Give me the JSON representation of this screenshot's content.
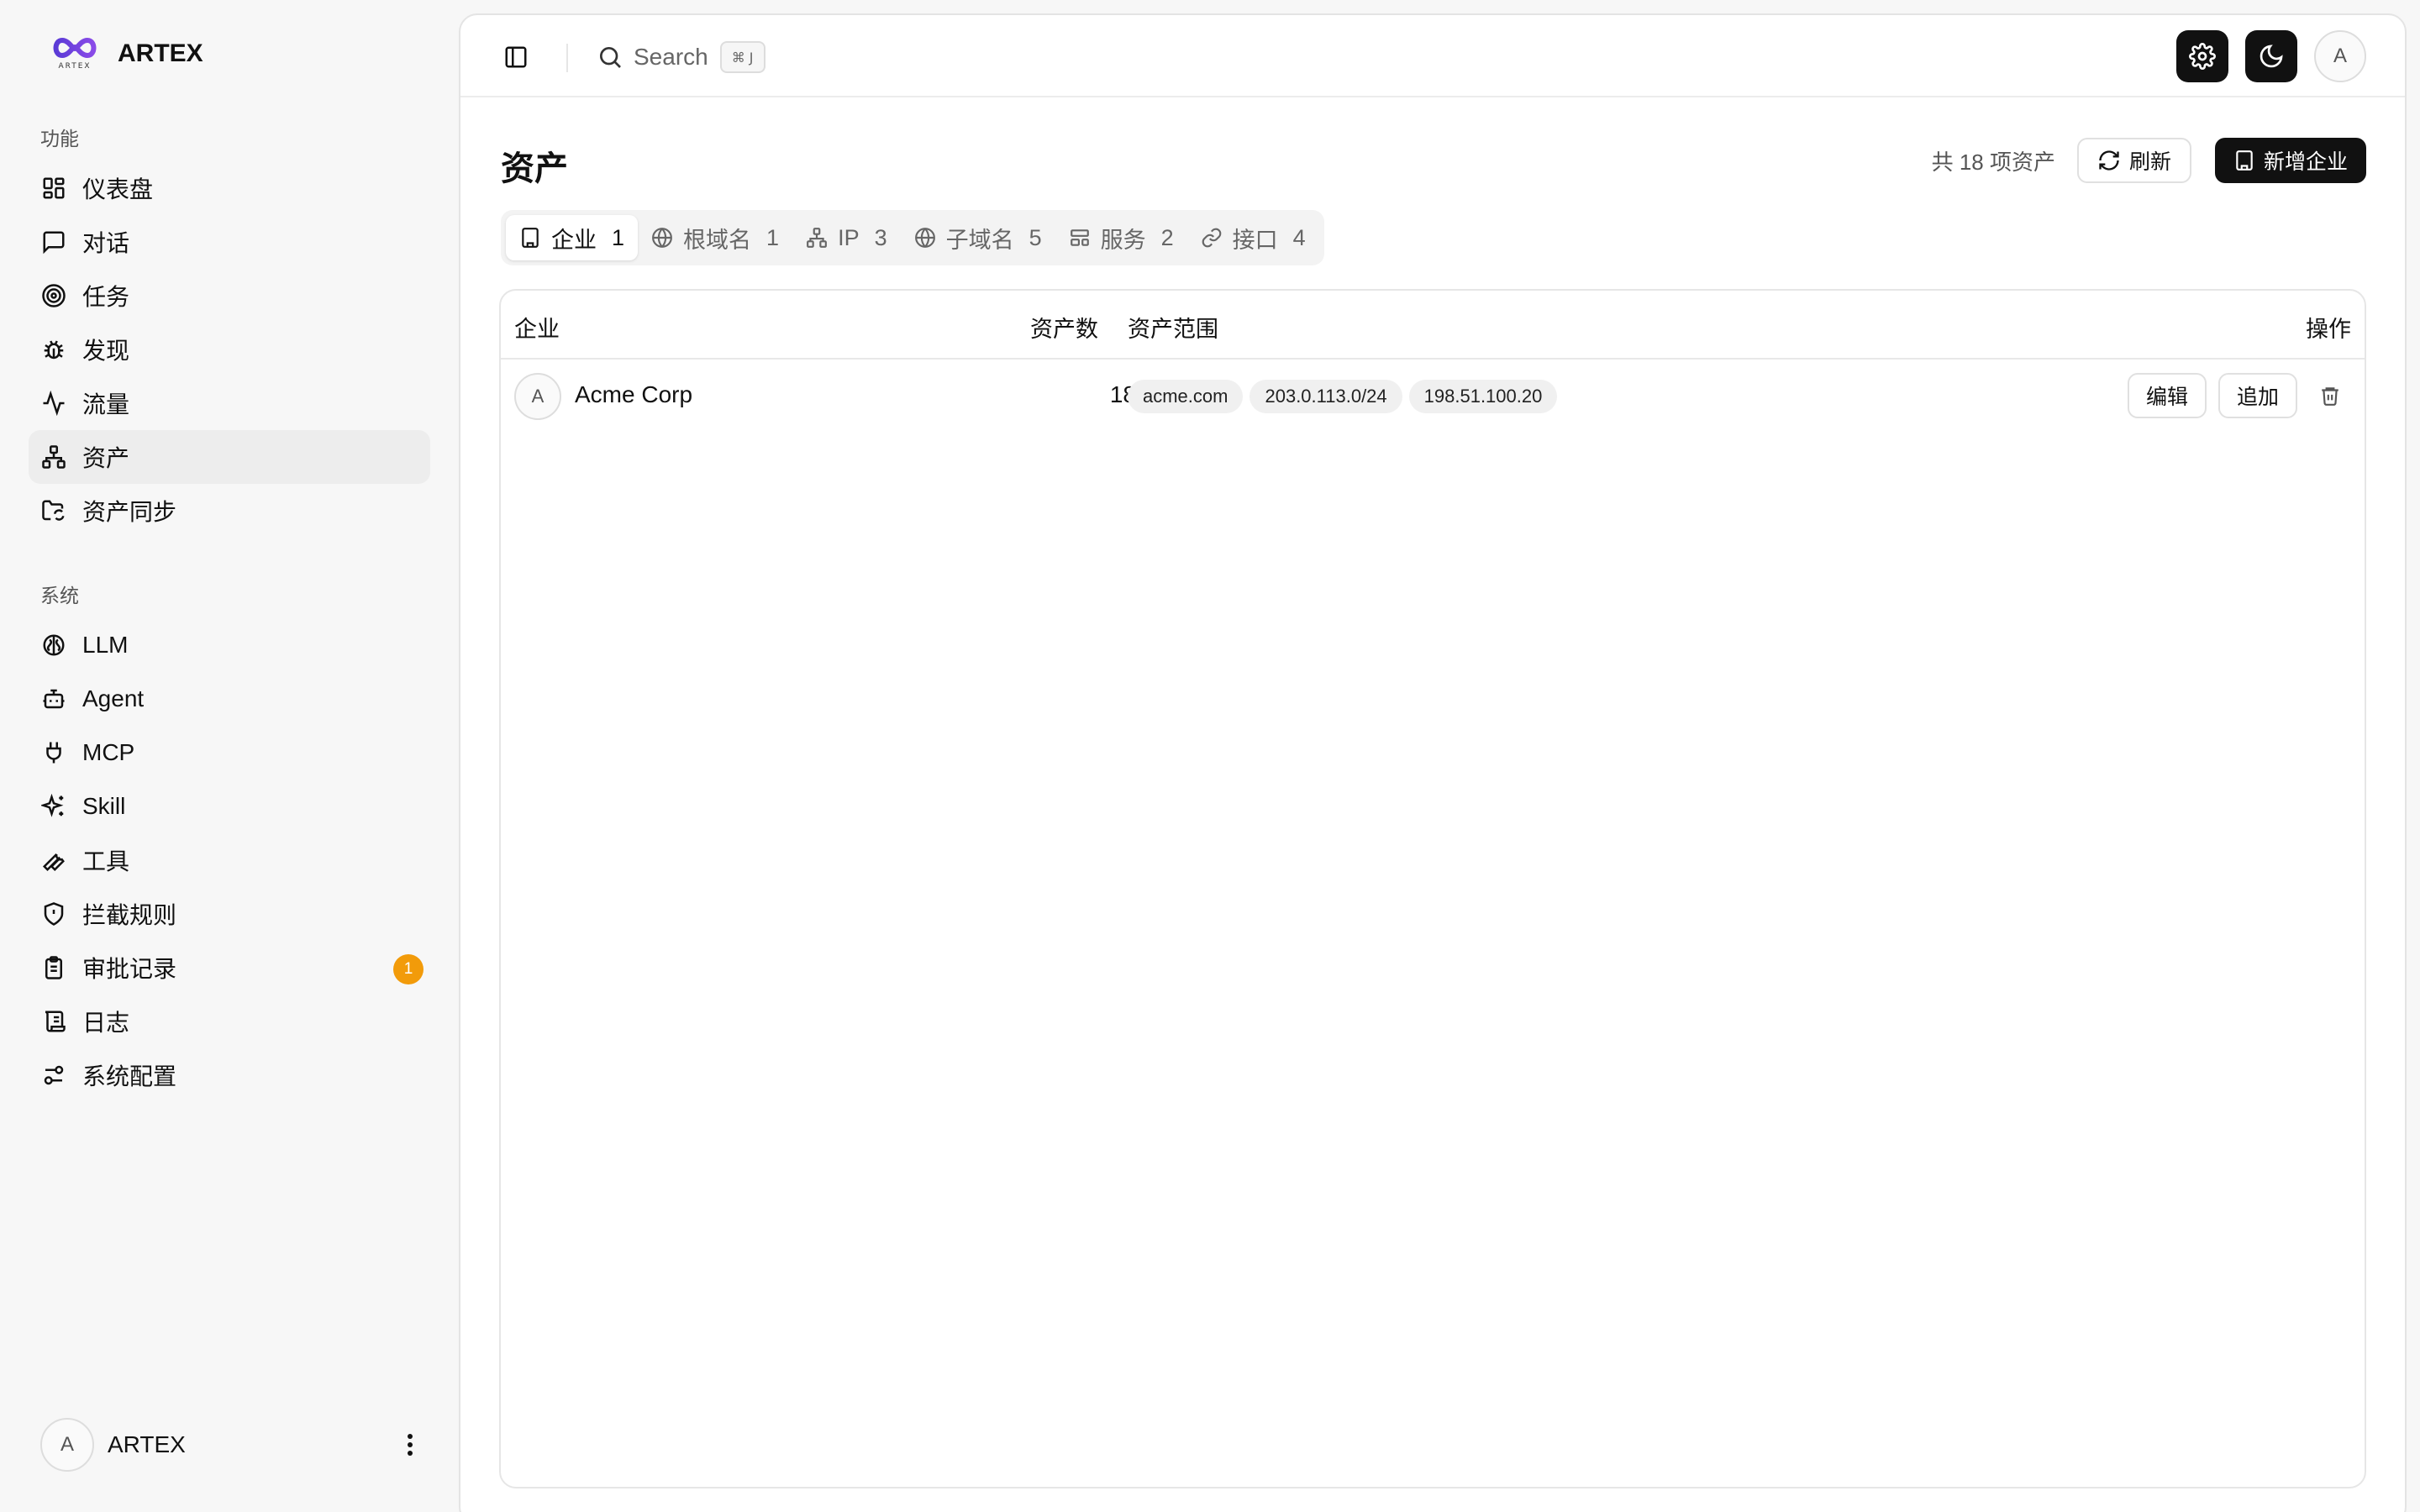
{
  "brand": {
    "name": "ARTEX",
    "logo_sub": "ARTEX"
  },
  "sidebar": {
    "section_features": "功能",
    "features": [
      {
        "label": "仪表盘",
        "icon": "dashboard-icon"
      },
      {
        "label": "对话",
        "icon": "chat-icon"
      },
      {
        "label": "任务",
        "icon": "target-icon"
      },
      {
        "label": "发现",
        "icon": "bug-icon"
      },
      {
        "label": "流量",
        "icon": "activity-icon"
      },
      {
        "label": "资产",
        "icon": "network-icon"
      },
      {
        "label": "资产同步",
        "icon": "folder-sync-icon"
      }
    ],
    "section_system": "系统",
    "system": [
      {
        "label": "LLM",
        "icon": "brain-icon"
      },
      {
        "label": "Agent",
        "icon": "bot-icon"
      },
      {
        "label": "MCP",
        "icon": "plug-icon"
      },
      {
        "label": "Skill",
        "icon": "sparkles-icon"
      },
      {
        "label": "工具",
        "icon": "wrench-icon"
      },
      {
        "label": "拦截规则",
        "icon": "shield-icon"
      },
      {
        "label": "审批记录",
        "icon": "clipboard-icon",
        "badge": "1"
      },
      {
        "label": "日志",
        "icon": "scroll-icon"
      },
      {
        "label": "系统配置",
        "icon": "settings-sliders-icon"
      }
    ],
    "active": "资产",
    "user": {
      "initial": "A",
      "name": "ARTEX"
    }
  },
  "topbar": {
    "search_placeholder": "Search",
    "shortcut": "⌘ J",
    "avatar_initial": "A"
  },
  "page": {
    "title": "资产",
    "total": "共 18 项资产",
    "refresh_label": "刷新",
    "add_label": "新增企业"
  },
  "tabs": [
    {
      "label": "企业",
      "count": "1",
      "icon": "building-icon",
      "active": true
    },
    {
      "label": "根域名",
      "count": "1",
      "icon": "globe-icon"
    },
    {
      "label": "IP",
      "count": "3",
      "icon": "network-icon"
    },
    {
      "label": "子域名",
      "count": "5",
      "icon": "globe-icon"
    },
    {
      "label": "服务",
      "count": "2",
      "icon": "service-icon"
    },
    {
      "label": "接口",
      "count": "4",
      "icon": "link-icon"
    }
  ],
  "table": {
    "headers": {
      "company": "企业",
      "count": "资产数",
      "scope": "资产范围",
      "actions": "操作"
    },
    "rows": [
      {
        "initial": "A",
        "name": "Acme Corp",
        "count": "18",
        "scopes": [
          "acme.com",
          "203.0.113.0/24",
          "198.51.100.20"
        ],
        "edit": "编辑",
        "append": "追加"
      }
    ]
  },
  "colors": {
    "accent": "#111111",
    "badge": "#f29b0a",
    "active_nav": "#ededed"
  }
}
